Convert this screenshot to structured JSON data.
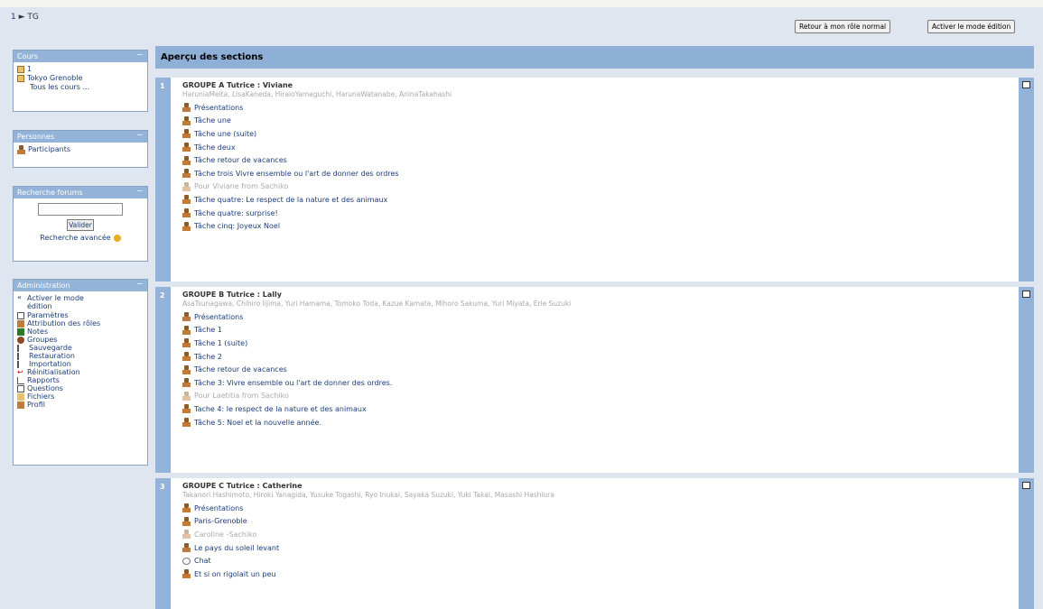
{
  "breadcrumb": {
    "home": "1",
    "separator": "►",
    "current": "TG"
  },
  "header_buttons": {
    "role": "Retour à mon rôle normal",
    "edit": "Activer le mode édition"
  },
  "blocks": {
    "cours": {
      "title": "Cours",
      "items": [
        "1",
        "Tokyo Grenoble"
      ],
      "all": "Tous les cours ..."
    },
    "personnes": {
      "title": "Personnes",
      "items": [
        "Participants"
      ]
    },
    "recherche": {
      "title": "Recherche forums",
      "button": "Valider",
      "advanced": "Recherche avancée"
    },
    "admin": {
      "title": "Administration",
      "items": [
        "Activer le mode édition",
        "Paramètres",
        "Attribution des rôles",
        "Notes",
        "Groupes",
        "Sauvegarde",
        "Restauration",
        "Importation",
        "Réinitialisation",
        "Rapports",
        "Questions",
        "Fichiers",
        "Profil"
      ]
    }
  },
  "main": {
    "heading": "Aperçu des sections",
    "sections": [
      {
        "num": "1",
        "title": "GROUPE A Tutrice : Viviane",
        "members": "HaruniaMeita, LisaKaneda, HiraioYamaguchi, HarunaWatanabe, AninaTakahashi",
        "activities": [
          {
            "label": "Présentations",
            "dim": false
          },
          {
            "label": "Tâche une",
            "dim": false
          },
          {
            "label": "Tâche une (suite)",
            "dim": false
          },
          {
            "label": "Tâche deux",
            "dim": false
          },
          {
            "label": "Tâche retour de vacances",
            "dim": false
          },
          {
            "label": "Tâche trois Vivre ensemble ou l'art de donner des ordres",
            "dim": false
          },
          {
            "label": "Pour Viviane from Sachiko",
            "dim": true
          },
          {
            "label": "Tâche quatre: Le respect de la nature et des animaux",
            "dim": false
          },
          {
            "label": "Tâche quatre: surprise!",
            "dim": false
          },
          {
            "label": "Tâche cinq: Joyeux Noel",
            "dim": false
          }
        ]
      },
      {
        "num": "2",
        "title": "GROUPE B Tutrice : Lally",
        "members": "AsaTsunagawa, Chihiro Iijima, Yuri Hamama, Tomoko Toda, Kazue Kamata, Mihoro Sakuma, Yuri Miyata, Erie Suzuki",
        "activities": [
          {
            "label": "Présentations",
            "dim": false
          },
          {
            "label": "Tâche 1",
            "dim": false
          },
          {
            "label": "Tâche 1 (suite)",
            "dim": false
          },
          {
            "label": "Tâche 2",
            "dim": false
          },
          {
            "label": "Tâche retour de vacances",
            "dim": false
          },
          {
            "label": "Tâche 3: Vivre ensemble ou l'art de donner des ordres.",
            "dim": false
          },
          {
            "label": "Pour Laetitia from Sachiko",
            "dim": true
          },
          {
            "label": "Tache 4: le respect de la nature et des animaux",
            "dim": false
          },
          {
            "label": "Tâche 5: Noel et la nouvelle année.",
            "dim": false
          }
        ]
      },
      {
        "num": "3",
        "title": "GROUPE C Tutrice : Catherine",
        "members": "Takanori Hashimoto, Hiroki Yanagida, Yusuke Togashi, Ryo Inukai, Sayaka Suzuki, Yuki Takai, Masashi Hashiura",
        "activities": [
          {
            "label": "Présentations",
            "dim": false,
            "icon": "person"
          },
          {
            "label": "Paris-Grenoble",
            "dim": false,
            "icon": "person"
          },
          {
            "label": "Caroline -Sachiko",
            "dim": true,
            "icon": "person"
          },
          {
            "label": "Le pays du soleil levant",
            "dim": false,
            "icon": "person"
          },
          {
            "label": "Chat",
            "dim": false,
            "icon": "chat"
          },
          {
            "label": "Et si on rigolait un peu",
            "dim": false,
            "icon": "person"
          }
        ]
      }
    ]
  },
  "colors": {
    "header_blue": "#8fb0d6",
    "link": "#1a3c7a",
    "dim": "#aaaaaa"
  }
}
